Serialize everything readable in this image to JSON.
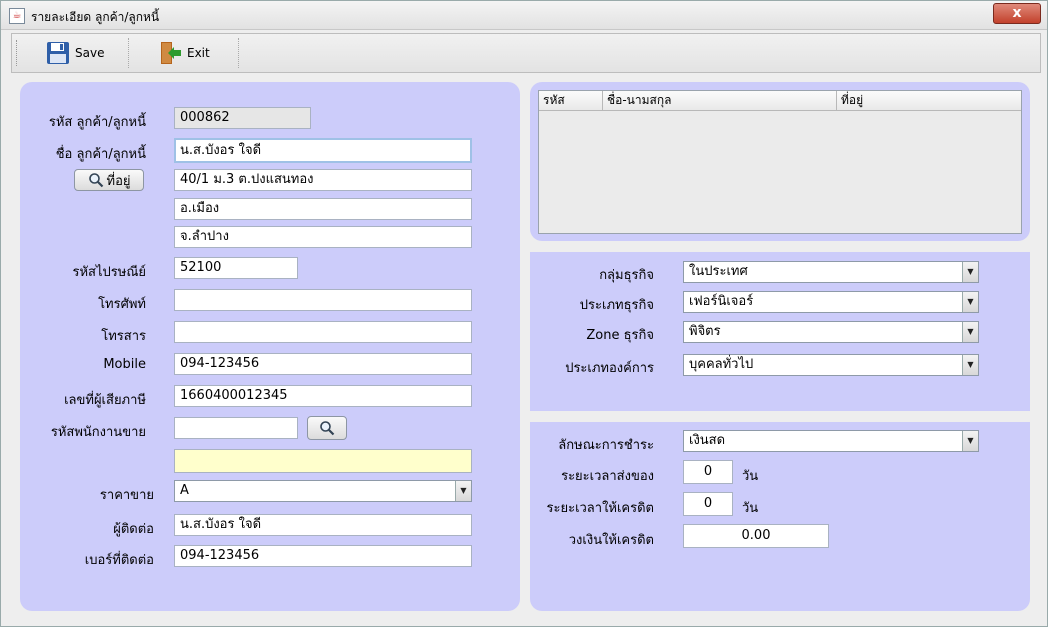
{
  "window": {
    "title": "รายละเอียด ลูกค้า/ลูกหนี้",
    "close_label": "x"
  },
  "toolbar": {
    "save_label": "Save",
    "exit_label": "Exit"
  },
  "customer": {
    "code_label": "รหัส ลูกค้า/ลูกหนี้",
    "code_value": "000862",
    "name_label": "ชื่อ ลูกค้า/ลูกหนี้",
    "name_value": "น.ส.บังอร ใจดี",
    "address_button": "ที่อยู่",
    "address_line1": "40/1 ม.3 ต.ปงแสนทอง",
    "address_line2": "อ.เมือง",
    "address_line3": "จ.ลำปาง",
    "postcode_label": "รหัสไปรษณีย์",
    "postcode_value": "52100",
    "phone_label": "โทรศัพท์",
    "phone_value": "",
    "fax_label": "โทรสาร",
    "fax_value": "",
    "mobile_label": "Mobile",
    "mobile_value": "094-123456",
    "taxid_label": "เลขที่ผู้เสียภาษี",
    "taxid_value": "1660400012345",
    "salesrep_label": "รหัสพนักงานขาย",
    "salesrep_value": "",
    "salesrep_name": "",
    "price_label": "ราคาขาย",
    "price_value": "A",
    "contact_label": "ผู้ติดต่อ",
    "contact_value": "น.ส.บังอร ใจดี",
    "contact_phone_label": "เบอร์ที่ติดต่อ",
    "contact_phone_value": "094-123456"
  },
  "table": {
    "columns": [
      "รหัส",
      "ชื่อ-นามสกุล",
      "ที่อยู่"
    ],
    "rows": []
  },
  "business": {
    "group_label": "กลุ่มธุรกิจ",
    "group_value": "ในประเทศ",
    "type_label": "ประเภทธุรกิจ",
    "type_value": "เฟอร์นิเจอร์",
    "zone_label": "Zone ธุรกิจ",
    "zone_value": "พิจิตร",
    "org_label": "ประเภทองค์การ",
    "org_value": "บุคคลทั่วไป"
  },
  "payment": {
    "method_label": "ลักษณะการชำระ",
    "method_value": "เงินสด",
    "delivery_label": "ระยะเวลาส่งของ",
    "delivery_value": "0",
    "delivery_unit": "วัน",
    "credit_label": "ระยะเวลาให้เครดิต",
    "credit_value": "0",
    "credit_unit": "วัน",
    "limit_label": "วงเงินให้เครดิต",
    "limit_value": "0.00"
  },
  "icons": [
    "app-icon",
    "save-icon",
    "exit-icon",
    "search-icon",
    "chevron-down-icon"
  ]
}
